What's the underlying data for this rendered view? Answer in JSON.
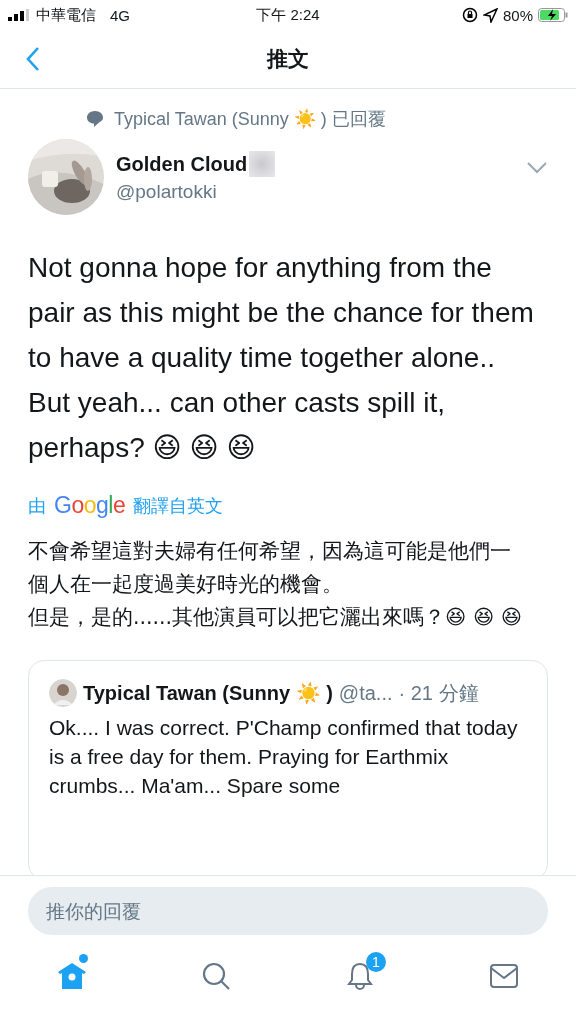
{
  "status_bar": {
    "carrier": "中華電信",
    "network": "4G",
    "time": "下午 2:24",
    "battery": "80%"
  },
  "nav": {
    "title": "推文"
  },
  "tweet": {
    "reply_context": "Typical Tawan (Sunny ☀️ ) 已回覆",
    "author": {
      "name": "Golden Cloud",
      "handle": "@polartokki"
    },
    "text": [
      "Not gonna hope for anything from the pair as this might be the chance for them to have a quality time together alone..",
      "But yeah... can other casts spill it, perhaps? 😆 😆 😆"
    ],
    "translation_credit": {
      "prefix": "由",
      "brand": "Google",
      "suffix": "翻譯自英文"
    },
    "translation": [
      "不會希望這對夫婦有任何希望，因為這可能是他們一個人在一起度過美好時光的機會。",
      "但是，是的......其他演員可以把它灑出來嗎？😆 😆 😆"
    ],
    "quoted": {
      "name": "Typical Tawan (Sunny ☀️ )",
      "handle": "@ta...",
      "time": "· 21 分鐘",
      "text": "Ok.... I was correct. P'Champ  confirmed that today is a free day for them. Praying for Earthmix crumbs... Ma'am... Spare some"
    }
  },
  "reply_field": {
    "placeholder": "推你的回覆"
  },
  "tab_bar": [
    {
      "kind": "home",
      "selected": true,
      "dot": true
    },
    {
      "kind": "search",
      "selected": false
    },
    {
      "kind": "notifications",
      "selected": false,
      "badge": "1"
    },
    {
      "kind": "messages",
      "selected": false
    }
  ]
}
